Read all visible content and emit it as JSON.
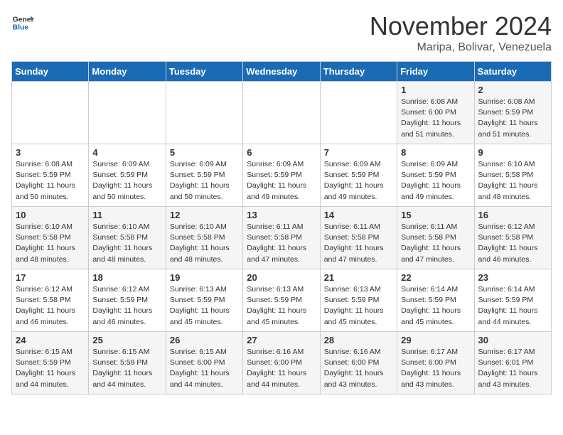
{
  "header": {
    "logo_general": "General",
    "logo_blue": "Blue",
    "month_year": "November 2024",
    "location": "Maripa, Bolivar, Venezuela"
  },
  "days_of_week": [
    "Sunday",
    "Monday",
    "Tuesday",
    "Wednesday",
    "Thursday",
    "Friday",
    "Saturday"
  ],
  "weeks": [
    [
      {
        "day": "",
        "sunrise": "",
        "sunset": "",
        "daylight": ""
      },
      {
        "day": "",
        "sunrise": "",
        "sunset": "",
        "daylight": ""
      },
      {
        "day": "",
        "sunrise": "",
        "sunset": "",
        "daylight": ""
      },
      {
        "day": "",
        "sunrise": "",
        "sunset": "",
        "daylight": ""
      },
      {
        "day": "",
        "sunrise": "",
        "sunset": "",
        "daylight": ""
      },
      {
        "day": "1",
        "sunrise": "6:08 AM",
        "sunset": "6:00 PM",
        "daylight": "11 hours and 51 minutes."
      },
      {
        "day": "2",
        "sunrise": "6:08 AM",
        "sunset": "5:59 PM",
        "daylight": "11 hours and 51 minutes."
      }
    ],
    [
      {
        "day": "3",
        "sunrise": "6:08 AM",
        "sunset": "5:59 PM",
        "daylight": "11 hours and 50 minutes."
      },
      {
        "day": "4",
        "sunrise": "6:09 AM",
        "sunset": "5:59 PM",
        "daylight": "11 hours and 50 minutes."
      },
      {
        "day": "5",
        "sunrise": "6:09 AM",
        "sunset": "5:59 PM",
        "daylight": "11 hours and 50 minutes."
      },
      {
        "day": "6",
        "sunrise": "6:09 AM",
        "sunset": "5:59 PM",
        "daylight": "11 hours and 49 minutes."
      },
      {
        "day": "7",
        "sunrise": "6:09 AM",
        "sunset": "5:59 PM",
        "daylight": "11 hours and 49 minutes."
      },
      {
        "day": "8",
        "sunrise": "6:09 AM",
        "sunset": "5:59 PM",
        "daylight": "11 hours and 49 minutes."
      },
      {
        "day": "9",
        "sunrise": "6:10 AM",
        "sunset": "5:58 PM",
        "daylight": "11 hours and 48 minutes."
      }
    ],
    [
      {
        "day": "10",
        "sunrise": "6:10 AM",
        "sunset": "5:58 PM",
        "daylight": "11 hours and 48 minutes."
      },
      {
        "day": "11",
        "sunrise": "6:10 AM",
        "sunset": "5:58 PM",
        "daylight": "11 hours and 48 minutes."
      },
      {
        "day": "12",
        "sunrise": "6:10 AM",
        "sunset": "5:58 PM",
        "daylight": "11 hours and 48 minutes."
      },
      {
        "day": "13",
        "sunrise": "6:11 AM",
        "sunset": "5:58 PM",
        "daylight": "11 hours and 47 minutes."
      },
      {
        "day": "14",
        "sunrise": "6:11 AM",
        "sunset": "5:58 PM",
        "daylight": "11 hours and 47 minutes."
      },
      {
        "day": "15",
        "sunrise": "6:11 AM",
        "sunset": "5:58 PM",
        "daylight": "11 hours and 47 minutes."
      },
      {
        "day": "16",
        "sunrise": "6:12 AM",
        "sunset": "5:58 PM",
        "daylight": "11 hours and 46 minutes."
      }
    ],
    [
      {
        "day": "17",
        "sunrise": "6:12 AM",
        "sunset": "5:58 PM",
        "daylight": "11 hours and 46 minutes."
      },
      {
        "day": "18",
        "sunrise": "6:12 AM",
        "sunset": "5:59 PM",
        "daylight": "11 hours and 46 minutes."
      },
      {
        "day": "19",
        "sunrise": "6:13 AM",
        "sunset": "5:59 PM",
        "daylight": "11 hours and 45 minutes."
      },
      {
        "day": "20",
        "sunrise": "6:13 AM",
        "sunset": "5:59 PM",
        "daylight": "11 hours and 45 minutes."
      },
      {
        "day": "21",
        "sunrise": "6:13 AM",
        "sunset": "5:59 PM",
        "daylight": "11 hours and 45 minutes."
      },
      {
        "day": "22",
        "sunrise": "6:14 AM",
        "sunset": "5:59 PM",
        "daylight": "11 hours and 45 minutes."
      },
      {
        "day": "23",
        "sunrise": "6:14 AM",
        "sunset": "5:59 PM",
        "daylight": "11 hours and 44 minutes."
      }
    ],
    [
      {
        "day": "24",
        "sunrise": "6:15 AM",
        "sunset": "5:59 PM",
        "daylight": "11 hours and 44 minutes."
      },
      {
        "day": "25",
        "sunrise": "6:15 AM",
        "sunset": "5:59 PM",
        "daylight": "11 hours and 44 minutes."
      },
      {
        "day": "26",
        "sunrise": "6:15 AM",
        "sunset": "6:00 PM",
        "daylight": "11 hours and 44 minutes."
      },
      {
        "day": "27",
        "sunrise": "6:16 AM",
        "sunset": "6:00 PM",
        "daylight": "11 hours and 44 minutes."
      },
      {
        "day": "28",
        "sunrise": "6:16 AM",
        "sunset": "6:00 PM",
        "daylight": "11 hours and 43 minutes."
      },
      {
        "day": "29",
        "sunrise": "6:17 AM",
        "sunset": "6:00 PM",
        "daylight": "11 hours and 43 minutes."
      },
      {
        "day": "30",
        "sunrise": "6:17 AM",
        "sunset": "6:01 PM",
        "daylight": "11 hours and 43 minutes."
      }
    ]
  ],
  "labels": {
    "sunrise_prefix": "Sunrise: ",
    "sunset_prefix": "Sunset: ",
    "daylight_prefix": "Daylight: "
  }
}
